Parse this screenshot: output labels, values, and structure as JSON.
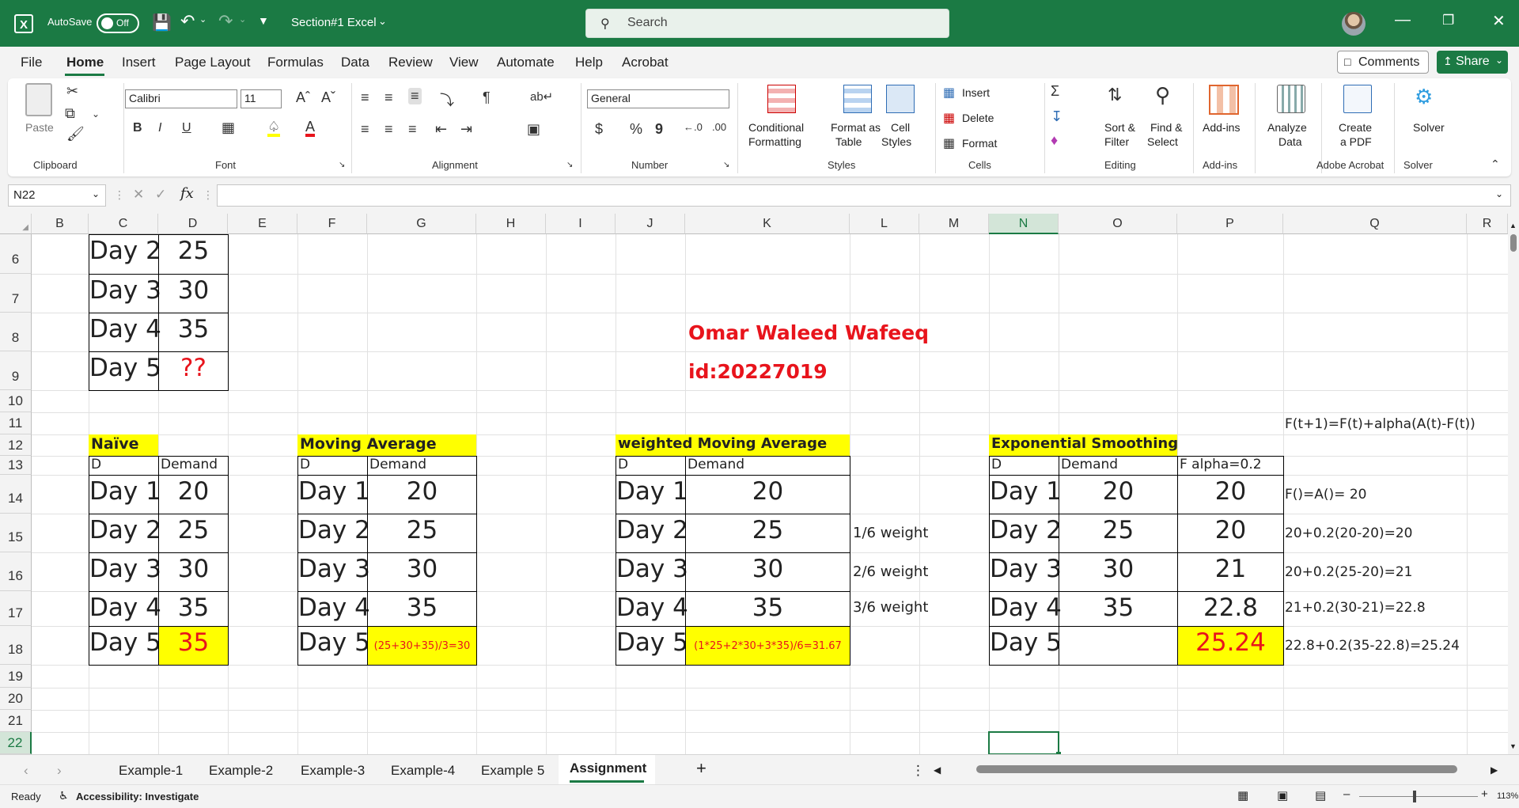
{
  "titlebar": {
    "autosave_label": "AutoSave",
    "toggle_label": "Off",
    "file_title": "Section#1 Excel",
    "search_placeholder": "Search"
  },
  "menu": {
    "tabs": [
      "File",
      "Home",
      "Insert",
      "Page Layout",
      "Formulas",
      "Data",
      "Review",
      "View",
      "Automate",
      "Help",
      "Acrobat"
    ],
    "comments_label": "Comments",
    "share_label": "Share"
  },
  "ribbon": {
    "clipboard": {
      "paste": "Paste",
      "group": "Clipboard"
    },
    "font": {
      "family": "Calibri",
      "size": "11",
      "group": "Font",
      "increase": "A^",
      "decrease": "Aˇ"
    },
    "alignment": {
      "group": "Alignment"
    },
    "number": {
      "format": "General",
      "group": "Number",
      "currency": "$",
      "percent": "%",
      "comma": "9"
    },
    "styles": {
      "conditional": "Conditional",
      "conditional2": "Formatting",
      "format_as": "Format as",
      "format_as2": "Table",
      "cell": "Cell",
      "cell2": "Styles",
      "group": "Styles"
    },
    "cells": {
      "insert": "Insert",
      "delete": "Delete",
      "format": "Format",
      "group": "Cells"
    },
    "editing": {
      "sort": "Sort &",
      "sort2": "Filter",
      "find": "Find &",
      "find2": "Select",
      "group": "Editing"
    },
    "addins": {
      "label": "Add-ins",
      "group": "Add-ins"
    },
    "analyze": {
      "label": "Analyze",
      "label2": "Data"
    },
    "acrobat": {
      "label": "Create",
      "label2": "a PDF",
      "group": "Adobe Acrobat"
    },
    "solver": {
      "label": "Solver",
      "group": "Solver"
    }
  },
  "formula_bar": {
    "name_box": "N22",
    "fx": "fx",
    "content": ""
  },
  "columns": [
    "B",
    "C",
    "D",
    "E",
    "F",
    "G",
    "H",
    "I",
    "J",
    "K",
    "L",
    "M",
    "N",
    "O",
    "P",
    "Q",
    "R"
  ],
  "rows": [
    "6",
    "7",
    "8",
    "9",
    "10",
    "11",
    "12",
    "13",
    "14",
    "15",
    "16",
    "17",
    "18",
    "19",
    "20",
    "21",
    "22"
  ],
  "top_table": {
    "rows": [
      {
        "day": "Day 2",
        "value": "25"
      },
      {
        "day": "Day 3",
        "value": "30"
      },
      {
        "day": "Day 4",
        "value": "35"
      },
      {
        "day": "Day 5",
        "value": "??"
      }
    ]
  },
  "author": {
    "name": "Omar Waleed Wafeeq",
    "id": "id:20227019"
  },
  "formula_note": "F(t+1)=F(t)+alpha(A(t)-F(t))",
  "naive": {
    "title": "Naïve",
    "col_d": "D",
    "col_demand": "Demand",
    "rows": [
      {
        "day": "Day 1",
        "value": "20"
      },
      {
        "day": "Day 2",
        "value": "25"
      },
      {
        "day": "Day 3",
        "value": "30"
      },
      {
        "day": "Day 4",
        "value": "35"
      },
      {
        "day": "Day 5",
        "value": "35"
      }
    ]
  },
  "moving_average": {
    "title": "Moving Average",
    "col_d": "D",
    "col_demand": "Demand",
    "rows": [
      {
        "day": "Day 1",
        "value": "20"
      },
      {
        "day": "Day 2",
        "value": "25"
      },
      {
        "day": "Day 3",
        "value": "30"
      },
      {
        "day": "Day 4",
        "value": "35"
      },
      {
        "day": "Day 5",
        "value": "(25+30+35)/3=30"
      }
    ]
  },
  "weighted_moving_average": {
    "title": "weighted Moving Average",
    "col_d": "D",
    "col_demand": "Demand",
    "rows": [
      {
        "day": "Day 1",
        "value": "20",
        "note": ""
      },
      {
        "day": "Day 2",
        "value": "25",
        "note": "1/6 weight"
      },
      {
        "day": "Day 3",
        "value": "30",
        "note": "2/6 weight"
      },
      {
        "day": "Day 4",
        "value": "35",
        "note": "3/6 weight"
      },
      {
        "day": "Day 5",
        "value": "(1*25+2*30+3*35)/6=31.67",
        "note": ""
      }
    ]
  },
  "exponential_smoothing": {
    "title": "Exponential Smoothing",
    "col_d": "D",
    "col_demand": "Demand",
    "col_f": "F alpha=0.2",
    "rows": [
      {
        "day": "Day 1",
        "demand": "20",
        "f": "20",
        "calc": "F()=A()= 20"
      },
      {
        "day": "Day 2",
        "demand": "25",
        "f": "20",
        "calc": "20+0.2(20-20)=20"
      },
      {
        "day": "Day 3",
        "demand": "30",
        "f": "21",
        "calc": "20+0.2(25-20)=21"
      },
      {
        "day": "Day 4",
        "demand": "35",
        "f": "22.8",
        "calc": "21+0.2(30-21)=22.8"
      },
      {
        "day": "Day 5",
        "demand": "",
        "f": "25.24",
        "calc": "22.8+0.2(35-22.8)=25.24"
      }
    ]
  },
  "sheets": [
    "Example-1",
    "Example-2",
    "Example-3",
    "Example-4",
    "Example 5",
    "Assignment"
  ],
  "status": {
    "ready": "Ready",
    "accessibility": "Accessibility: Investigate",
    "zoom": "113%"
  },
  "colors": {
    "accent": "#1b7a44",
    "highlight": "#ffff00",
    "red_text": "#e8141c"
  }
}
